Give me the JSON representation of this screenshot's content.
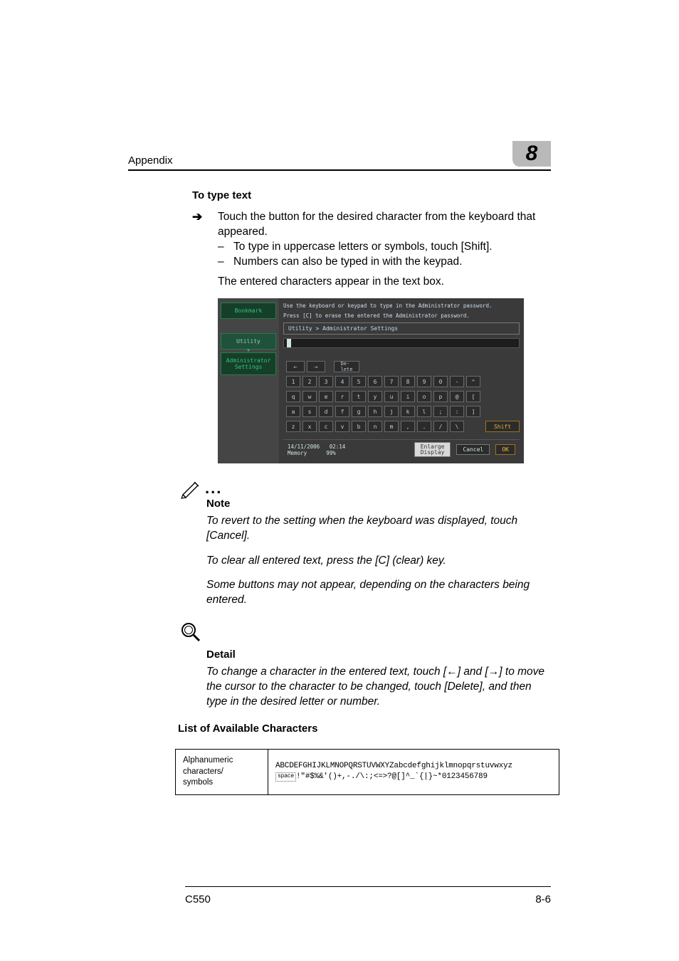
{
  "header": {
    "left": "Appendix",
    "num": "8"
  },
  "section_title": "To type text",
  "step": {
    "main": "Touch the button for the desired character from the keyboard that appeared.",
    "sub1": "To type in uppercase letters or symbols, touch [Shift].",
    "sub2": "Numbers can also be typed in with the keypad."
  },
  "result_line": "The entered characters appear in the text box.",
  "shot": {
    "hint1": "Use the keyboard or keypad to type in the Administrator password.",
    "hint2": "Press [C] to erase the entered the Administrator password.",
    "crumb": "Utility > Administrator Settings",
    "side": {
      "bookmark": "Bookmark",
      "utility": "Utility",
      "admin": "Administrator\nSettings"
    },
    "nav_left": "←",
    "nav_right": "→",
    "delete": "De-\nlete",
    "row1": [
      "1",
      "2",
      "3",
      "4",
      "5",
      "6",
      "7",
      "8",
      "9",
      "0",
      "-",
      "^"
    ],
    "row2": [
      "q",
      "w",
      "e",
      "r",
      "t",
      "y",
      "u",
      "i",
      "o",
      "p",
      "@",
      "["
    ],
    "row3": [
      "a",
      "s",
      "d",
      "f",
      "g",
      "h",
      "j",
      "k",
      "l",
      ";",
      ":",
      "]"
    ],
    "row4": [
      "z",
      "x",
      "c",
      "v",
      "b",
      "n",
      "m",
      ",",
      ".",
      "/",
      "\\"
    ],
    "shift": "Shift",
    "footer": {
      "date": "14/11/2006",
      "time": "02:14",
      "mem": "Memory",
      "pct": "99%",
      "enlarge": "Enlarge\nDisplay",
      "cancel": "Cancel",
      "ok": "OK"
    }
  },
  "note": {
    "label": "Note",
    "p1": "To revert to the setting when the keyboard was displayed, touch [Cancel].",
    "p2": "To clear all entered text, press the [C] (clear) key.",
    "p3": "Some buttons may not appear, depending on the characters being entered."
  },
  "detail": {
    "label": "Detail",
    "p_a": "To change a character in the entered text, touch [",
    "arrL": "←",
    "p_b": "] and [",
    "arrR": "→",
    "p_c": "] to move the cursor to the character to be changed, touch [Delete], and then type in the desired letter or number."
  },
  "list_heading": "List of Available Characters",
  "table": {
    "c1a": "Alphanumeric",
    "c1b": "characters/",
    "c1c": "symbols",
    "line1": "ABCDEFGHIJKLMNOPQRSTUVWXYZabcdefghijklmnopqrstuvwxyz",
    "space_label": "space",
    "line2_tail": "!\"#$%&'()+,-./\\:;<=>?@[]^_`{|}~*0123456789"
  },
  "footer": {
    "model": "C550",
    "page": "8-6"
  }
}
